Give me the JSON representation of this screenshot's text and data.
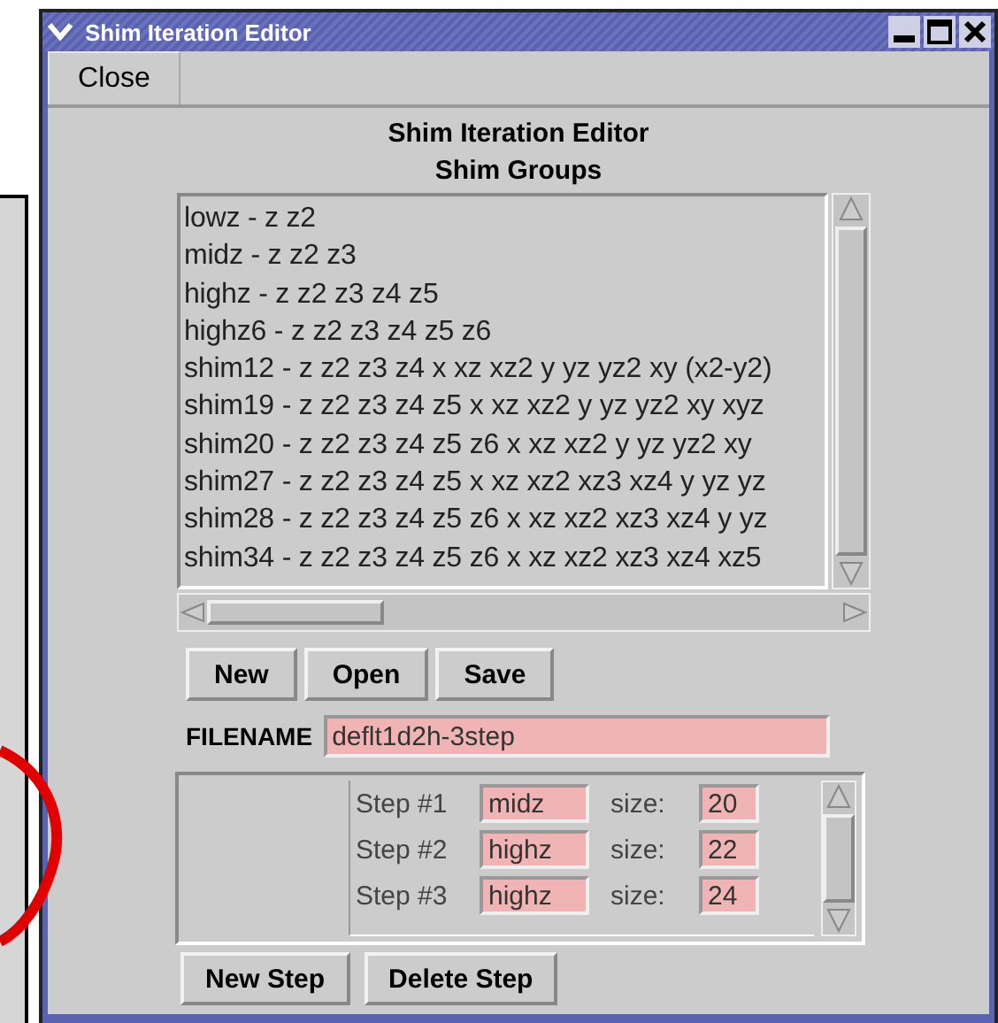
{
  "window": {
    "title": "Shim Iteration Editor"
  },
  "menu_bar": {
    "buttons": [
      "Close"
    ]
  },
  "heading": "Shim Iteration Editor",
  "groups": {
    "label": "Shim Groups",
    "items": [
      "lowz - z z2",
      "midz - z z2 z3",
      "highz - z z2 z3 z4 z5",
      "highz6 - z z2 z3 z4 z5 z6",
      "shim12 - z z2 z3 z4 x xz xz2 y yz yz2 xy (x2-y2)",
      "shim19 - z z2 z3 z4 z5 x xz xz2 y yz yz2 xy xyz",
      "shim20 - z z2 z3 z4 z5 z6 x xz xz2 y yz yz2 xy",
      "shim27 - z z2 z3 z4 z5 x xz xz2 xz3 xz4 y yz yz",
      "shim28 - z z2 z3 z4 z5 z6 x xz xz2 xz3 xz4 y yz",
      "shim34 - z z2 z3 z4 z5 z6 x xz xz2 xz3 xz4 xz5"
    ]
  },
  "file_buttons": [
    "New",
    "Open",
    "Save"
  ],
  "filename": {
    "label": "FILENAME",
    "value": "deflt1d2h-3step"
  },
  "steps": [
    {
      "label": "Step #1",
      "group": "midz",
      "size_label": "size:",
      "size": "20"
    },
    {
      "label": "Step #2",
      "group": "highz",
      "size_label": "size:",
      "size": "22"
    },
    {
      "label": "Step #3",
      "group": "highz",
      "size_label": "size:",
      "size": "24"
    }
  ],
  "step_buttons": [
    "New Step",
    "Delete Step"
  ]
}
